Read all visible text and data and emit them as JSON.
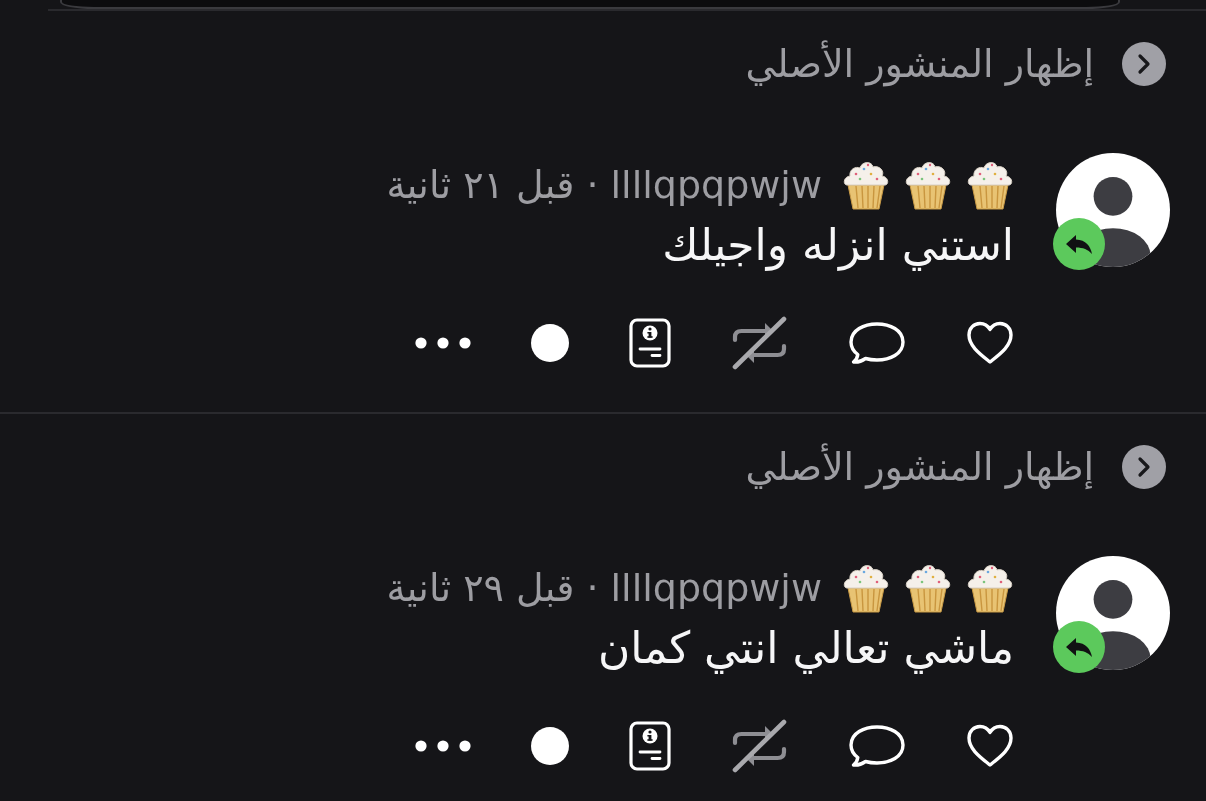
{
  "posts": [
    {
      "show_original": {
        "label": "إظهار المنشور الأصلي"
      },
      "author": {
        "handle": "llllqpqpwjw"
      },
      "separator": "·",
      "time": "قبل ٢١ ثانية",
      "text": "استني انزله واجيلك",
      "repost": {
        "disabled": true
      }
    },
    {
      "show_original": {
        "label": "إظهار المنشور الأصلي"
      },
      "author": {
        "handle": "llllqpqpwjw"
      },
      "separator": "·",
      "time": "قبل ٢٩ ثانية",
      "text": "ماشي تعالي انتي كمان",
      "repost": {
        "disabled": true
      }
    }
  ]
}
